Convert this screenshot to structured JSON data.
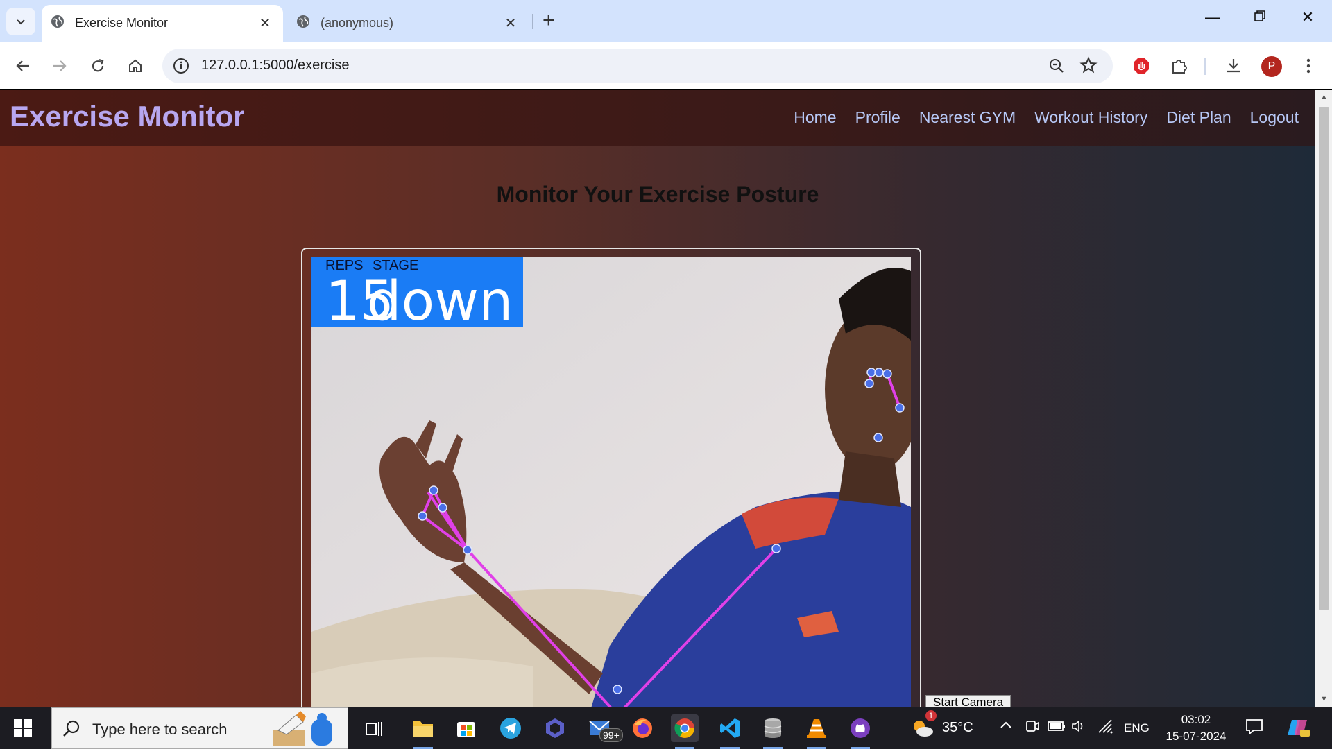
{
  "browser": {
    "tabs": [
      {
        "title": "Exercise Monitor",
        "active": true
      },
      {
        "title": "(anonymous)",
        "active": false
      }
    ],
    "address_url": "127.0.0.1:5000/exercise",
    "profile_initial": "P"
  },
  "site": {
    "brand": "Exercise Monitor",
    "nav": [
      "Home",
      "Profile",
      "Nearest GYM",
      "Workout History",
      "Diet Plan",
      "Logout"
    ],
    "heading": "Monitor Your Exercise Posture",
    "overlay": {
      "reps_label": "REPS",
      "stage_label": "STAGE",
      "reps_value": "15",
      "stage_value": "down"
    },
    "start_camera_label": "Start Camera"
  },
  "taskbar": {
    "search_placeholder": "Type here to search",
    "mail_badge": "99+",
    "weather_badge": "1",
    "temperature": "35°C",
    "language": "ENG",
    "time": "03:02",
    "date": "15-07-2024"
  },
  "colors": {
    "brand": "#b8a7f0",
    "nav_link": "#b7c8f6",
    "overlay_bg": "#1a7cf5",
    "skeleton_line": "#e040e8",
    "skeleton_point": "#4a6fe8"
  }
}
